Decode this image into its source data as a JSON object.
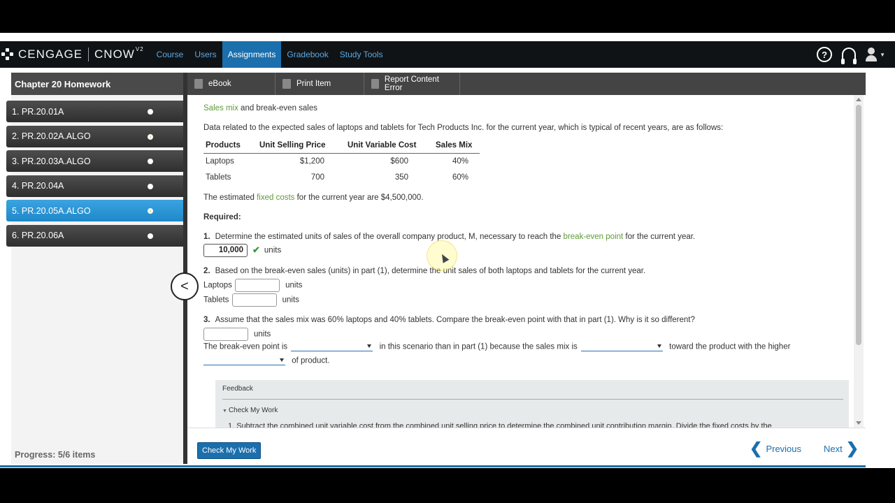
{
  "app": {
    "brand": "CENGAGE",
    "product": "CNOW",
    "product_version": "V2",
    "nav": [
      "Course",
      "Users",
      "Assignments",
      "Gradebook",
      "Study Tools"
    ]
  },
  "sidebar": {
    "title": "Chapter 20 Homework",
    "items": [
      {
        "label": "1. PR.20.01A"
      },
      {
        "label": "2. PR.20.02A.ALGO"
      },
      {
        "label": "3. PR.20.03A.ALGO"
      },
      {
        "label": "4. PR.20.04A"
      },
      {
        "label": "5. PR.20.05A.ALGO"
      },
      {
        "label": "6. PR.20.06A"
      }
    ],
    "progress": "Progress:  5/6 items"
  },
  "toolbar": {
    "ebook": "eBook",
    "print": "Print Item",
    "report": "Report Content Error"
  },
  "problem": {
    "heading_link": "Sales mix",
    "heading_rest": " and break-even sales",
    "intro": "Data related to the expected sales of laptops and tablets for Tech Products Inc. for the current year, which is typical of recent years, are as follows:",
    "table": {
      "headers": [
        "Products",
        "Unit Selling Price",
        "Unit Variable Cost",
        "Sales Mix"
      ],
      "rows": [
        [
          "Laptops",
          "$1,200",
          "$600",
          "40%"
        ],
        [
          "Tablets",
          "700",
          "350",
          "60%"
        ]
      ]
    },
    "fixed_pre": "The estimated ",
    "fixed_link": "fixed costs",
    "fixed_post": " for the current year are $4,500,000.",
    "required": "Required:",
    "q1": {
      "num": "1.",
      "text_pre": "Determine the estimated units of sales of the overall company product, M, necessary to reach the ",
      "text_link": "break-even point",
      "text_post": " for the current year.",
      "answer": "10,000",
      "unit": "units"
    },
    "q2": {
      "num": "2.",
      "text": "Based on the break-even sales (units) in part (1), determine the unit sales of both laptops and tablets for the current year.",
      "laptops_label": "Laptops",
      "tablets_label": "Tablets",
      "unit": "units"
    },
    "q3": {
      "num": "3.",
      "text": "Assume that the sales mix was 60% laptops and 40% tablets. Compare the break-even point with that in part (1). Why is it so different?",
      "unit": "units",
      "s1": "The break-even point is",
      "s2": "in this scenario than in part (1) because the sales mix is",
      "s3": "toward the product with the higher",
      "s4": "of product."
    }
  },
  "feedback": {
    "title": "Feedback",
    "toggle": "Check My Work",
    "text": "1. Subtract the combined unit variable cost from the combined unit selling price to determine the combined unit contribution margin. Divide the fixed costs by the"
  },
  "footer": {
    "check": "Check My Work",
    "previous": "Previous",
    "next": "Next"
  }
}
